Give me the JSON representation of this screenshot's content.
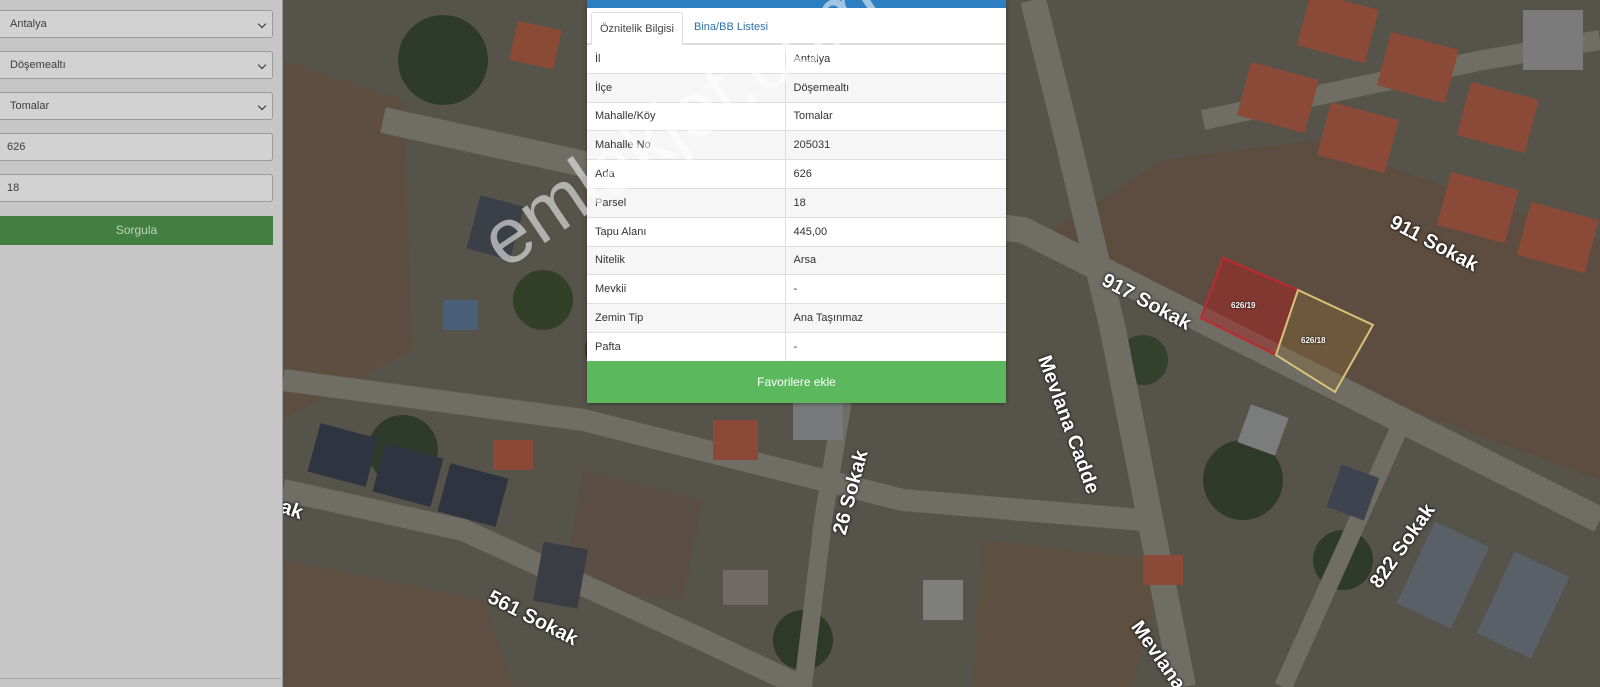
{
  "search": {
    "province": "Antalya",
    "district": "Döşemealtı",
    "neighborhood": "Tomalar",
    "block_no": "626",
    "parcel_no": "18",
    "query_button": "Sorgula"
  },
  "popup": {
    "tabs": [
      "Öznitelik Bilgisi",
      "Bina/BB Listesi"
    ],
    "active_tab": "Öznitelik Bilgisi",
    "rows": [
      {
        "key": "İl",
        "value": "Antalya"
      },
      {
        "key": "İlçe",
        "value": "Döşemealtı"
      },
      {
        "key": "Mahalle/Köy",
        "value": "Tomalar"
      },
      {
        "key": "Mahalle No",
        "value": "205031"
      },
      {
        "key": "Ada",
        "value": "626"
      },
      {
        "key": "Parsel",
        "value": "18"
      },
      {
        "key": "Tapu Alanı",
        "value": "445,00"
      },
      {
        "key": "Nitelik",
        "value": "Arsa"
      },
      {
        "key": "Mevkii",
        "value": "-"
      },
      {
        "key": "Zemin Tip",
        "value": "Ana Taşınmaz"
      },
      {
        "key": "Pafta",
        "value": "-"
      }
    ],
    "favorite_button": "Favorilere ekle"
  },
  "map": {
    "road_labels": [
      "917 Sokak",
      "911 Sokak",
      "Mevlana Cadde",
      "Mevlana C",
      "26 Sokak",
      "561 Sokak",
      "822 Sokak",
      "ak"
    ],
    "parcel_labels": [
      "626/19",
      "626/18"
    ],
    "watermark": "emlakjet.com"
  },
  "colors": {
    "accent_blue": "#2e7ec2",
    "favorite_green": "#5cb85c",
    "query_green": "#4a8a48",
    "selected_parcel": "#d8c27a",
    "neighbor_parcel": "#c0282d"
  }
}
